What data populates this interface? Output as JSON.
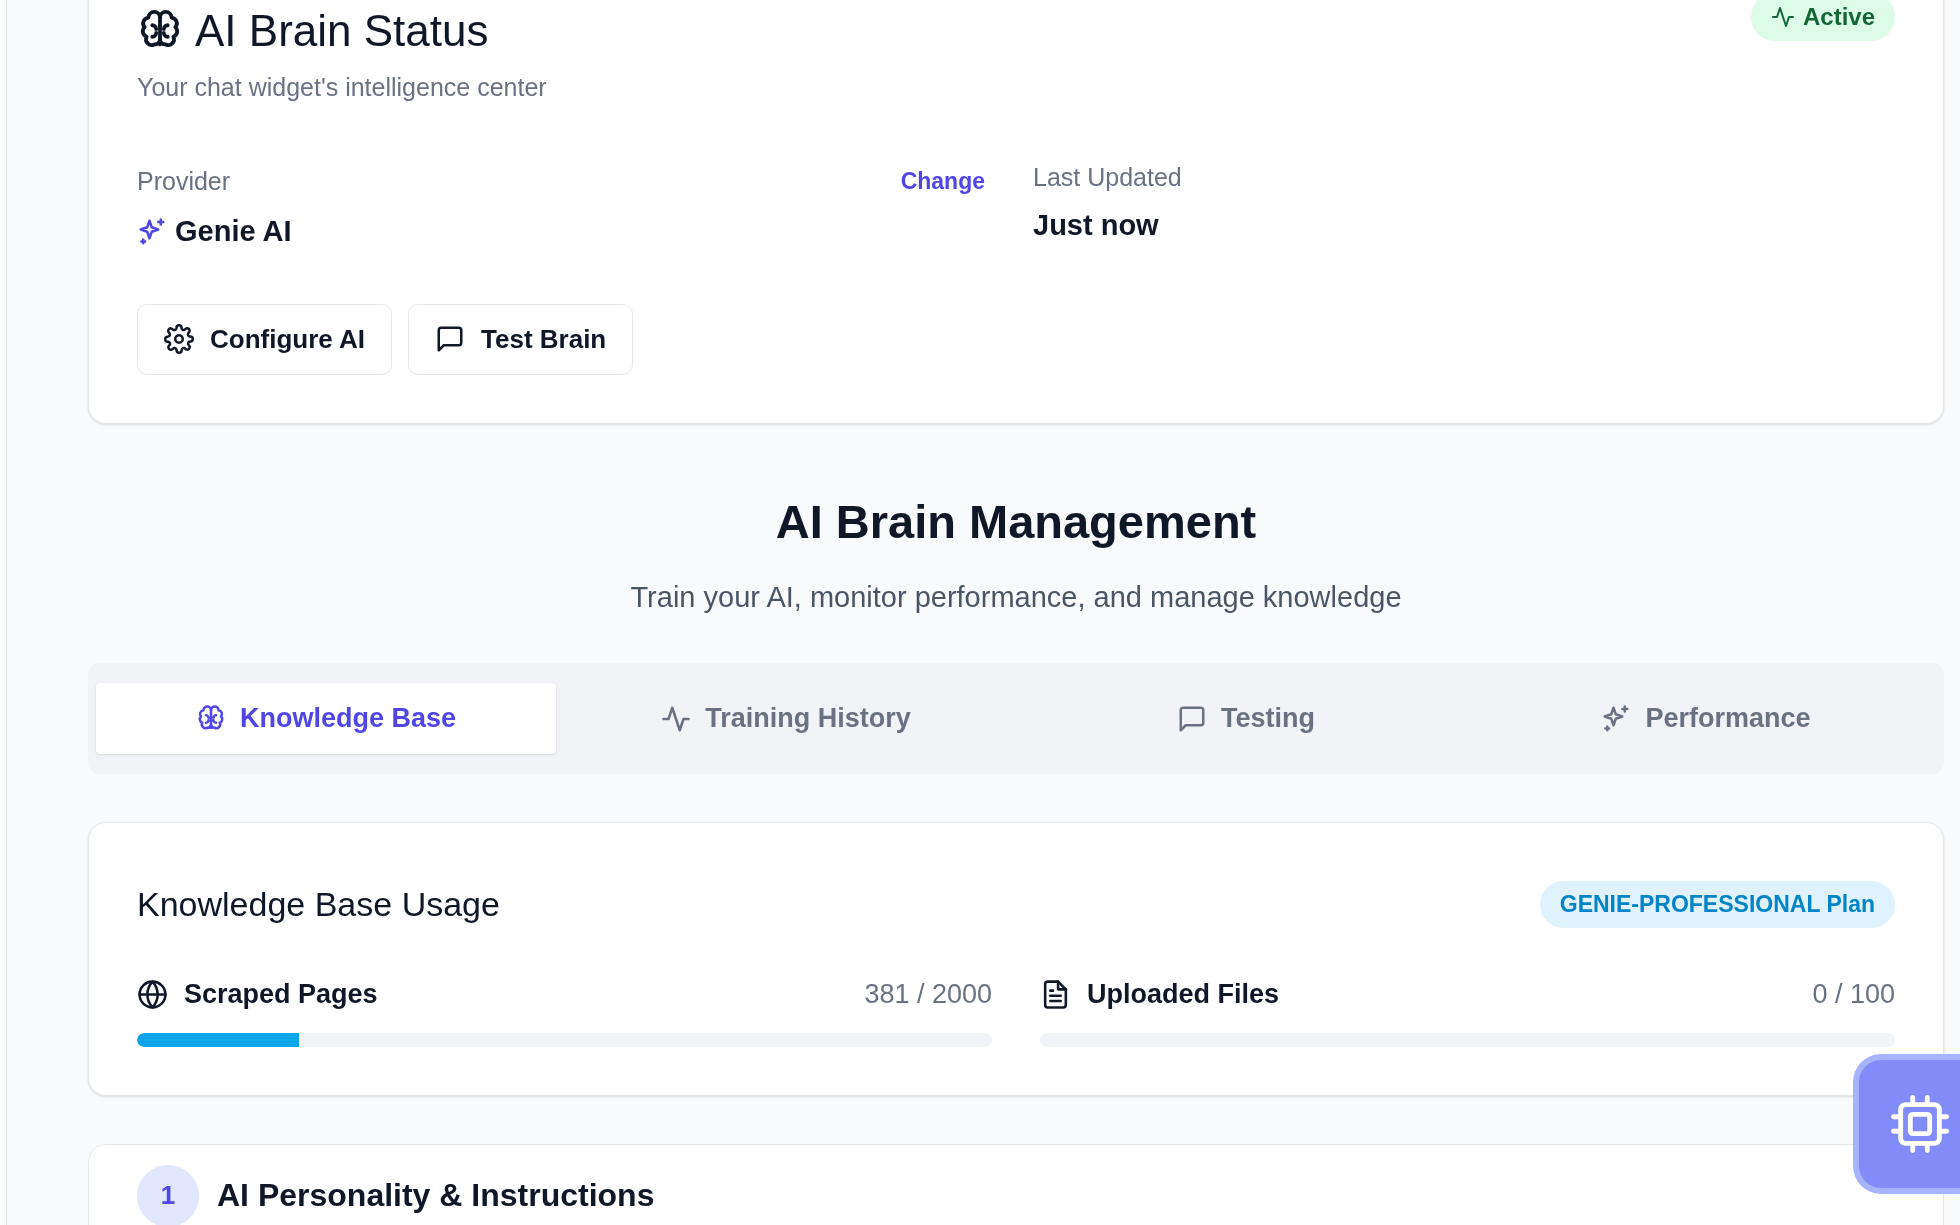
{
  "status_card": {
    "title": "AI Brain Status",
    "subtitle": "Your chat widget's intelligence center",
    "badge": "Active",
    "provider": {
      "label": "Provider",
      "value": "Genie AI",
      "action": "Change"
    },
    "last_updated": {
      "label": "Last Updated",
      "value": "Just now"
    },
    "buttons": [
      {
        "label": "Configure AI"
      },
      {
        "label": "Test Brain"
      }
    ]
  },
  "management": {
    "title": "AI Brain Management",
    "subtitle": "Train your AI, monitor performance, and manage knowledge"
  },
  "tabs": [
    {
      "label": "Knowledge Base",
      "selected": true
    },
    {
      "label": "Training History",
      "selected": false
    },
    {
      "label": "Testing",
      "selected": false
    },
    {
      "label": "Performance",
      "selected": false
    }
  ],
  "usage_card": {
    "title": "Knowledge Base Usage",
    "plan_badge": "GENIE-PROFESSIONAL Plan",
    "meters": [
      {
        "label": "Scraped Pages",
        "reading": "381 / 2000",
        "level": 0.19
      },
      {
        "label": "Uploaded Files",
        "reading": "0 / 100",
        "level": 0
      }
    ]
  },
  "next_section": {
    "number": "1",
    "title": "AI Personality & Instructions"
  }
}
